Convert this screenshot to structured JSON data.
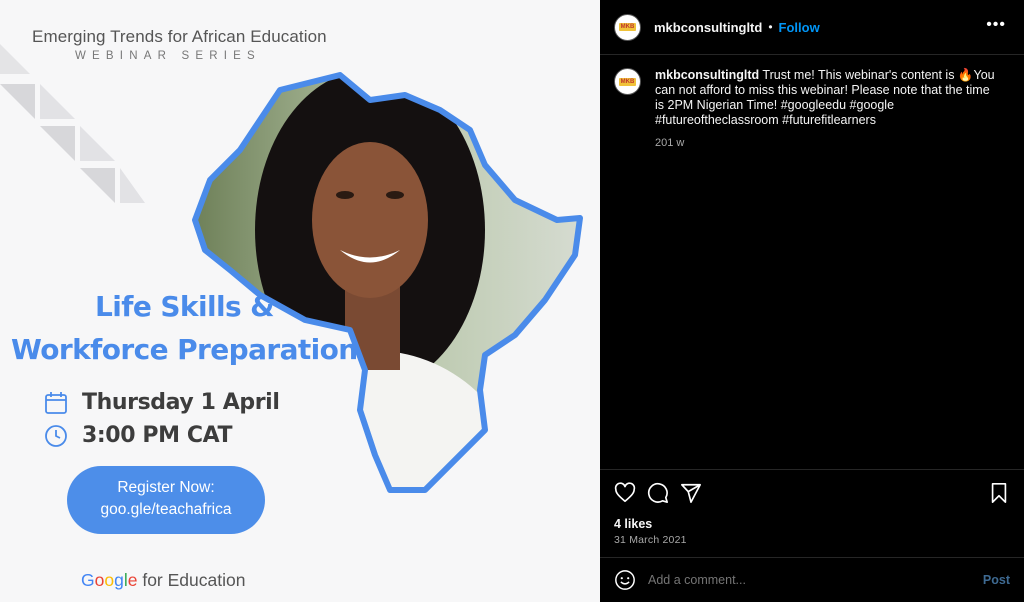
{
  "poster": {
    "title": "Emerging Trends for African Education",
    "series": "WEBINAR SERIES",
    "headline_line1": "Life Skills &",
    "headline_line2": "Workforce Preparation",
    "date": "Thursday 1 April",
    "time": "3:00 PM CAT",
    "register_line1": "Register Now:",
    "register_line2": "goo.gle/teachafrica",
    "brand_suffix": "for Education",
    "brand_letters": [
      "G",
      "o",
      "o",
      "g",
      "l",
      "e"
    ]
  },
  "header": {
    "username": "mkbconsultingltd",
    "separator": "•",
    "follow_label": "Follow",
    "more_label": "•••",
    "avatar_text": "MKB"
  },
  "caption": {
    "username": "mkbconsultingltd",
    "text": "Trust me! This webinar's content is 🔥You can not afford to miss this webinar! Please note that the time is 2PM Nigerian Time! #googleedu #google #futureoftheclassroom #futurefitlearners",
    "age": "201 w"
  },
  "actions": {
    "likes": "4 likes",
    "date": "31 March 2021"
  },
  "comment": {
    "placeholder": "Add a comment...",
    "post_label": "Post"
  },
  "colors": {
    "accent_blue": "#4a8bea",
    "follow_blue": "#0095f6",
    "post_blue": "#3e6a92",
    "background": "#000000"
  },
  "icons": [
    "heart-icon",
    "comment-icon",
    "share-icon",
    "bookmark-icon",
    "emoji-icon",
    "calendar-icon",
    "clock-icon"
  ]
}
